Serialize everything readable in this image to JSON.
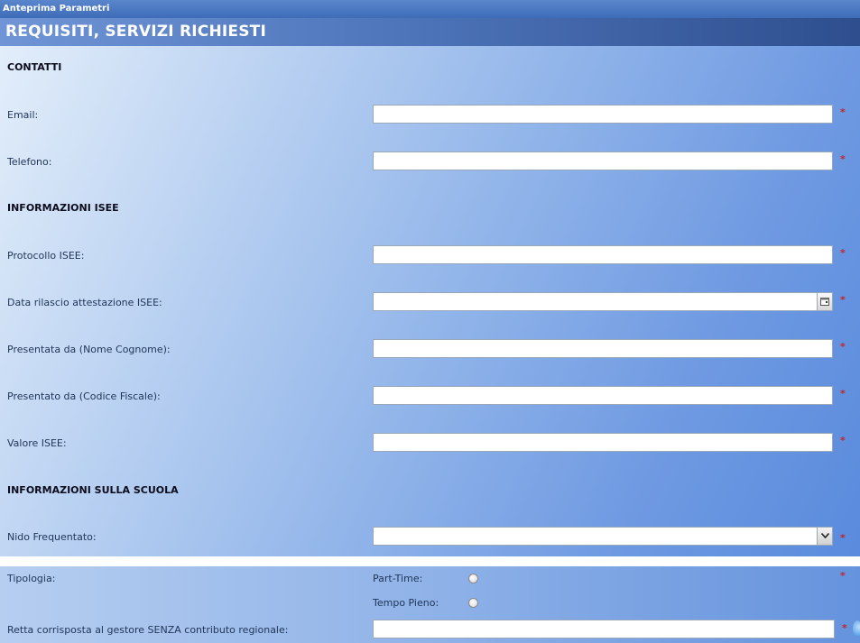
{
  "window": {
    "title": "Anteprima Parametri"
  },
  "page": {
    "title": "REQUISITI, SERVIZI RICHIESTI"
  },
  "required_mark": "*",
  "sections": {
    "contatti": "CONTATTI",
    "isee": "INFORMAZIONI ISEE",
    "scuola": "INFORMAZIONI SULLA SCUOLA"
  },
  "fields": {
    "email": {
      "label": "Email:",
      "value": ""
    },
    "telefono": {
      "label": "Telefono:",
      "value": ""
    },
    "protocollo_isee": {
      "label": "Protocollo ISEE:",
      "value": ""
    },
    "data_rilascio": {
      "label": "Data rilascio attestazione ISEE:",
      "value": ""
    },
    "presentata_nome": {
      "label": "Presentata da (Nome Cognome):",
      "value": ""
    },
    "presentato_cf": {
      "label": "Presentato da (Codice Fiscale):",
      "value": ""
    },
    "valore_isee": {
      "label": "Valore ISEE:",
      "value": ""
    },
    "nido": {
      "label": "Nido Frequentato:",
      "value": ""
    },
    "retta": {
      "label": "Retta corrisposta al gestore SENZA contributo regionale:",
      "value": ""
    }
  },
  "tipologia": {
    "label": "Tipologia:",
    "options": [
      "Part-Time:",
      "Tempo Pieno:"
    ]
  },
  "icons": {
    "calendar": "calendar-icon",
    "dropdown": "chevron-down-icon"
  }
}
